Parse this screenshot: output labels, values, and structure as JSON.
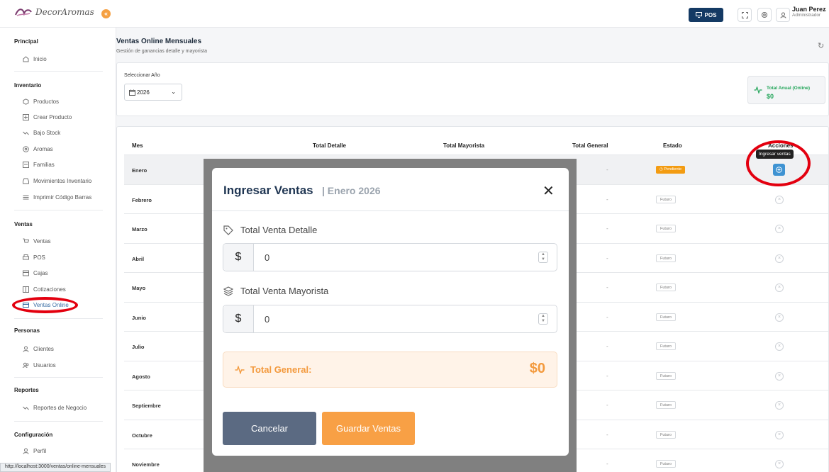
{
  "brand": {
    "name": "DecorAromas"
  },
  "topbar": {
    "pos_label": "POS",
    "user_name": "Juan Perez",
    "user_role": "Administrador"
  },
  "sidebar": {
    "sections": [
      {
        "title": "Principal",
        "items": [
          {
            "label": "Inicio",
            "icon": "home-icon"
          }
        ]
      },
      {
        "title": "Inventario",
        "items": [
          {
            "label": "Productos",
            "icon": "box-icon"
          },
          {
            "label": "Crear Producto",
            "icon": "plus-square-icon"
          },
          {
            "label": "Bajo Stock",
            "icon": "trending-down-icon"
          },
          {
            "label": "Aromas",
            "icon": "flower-icon"
          },
          {
            "label": "Familias",
            "icon": "folder-icon"
          },
          {
            "label": "Movimientos Inventario",
            "icon": "inbox-icon"
          },
          {
            "label": "Imprimir Código Barras",
            "icon": "barcode-icon"
          }
        ]
      },
      {
        "title": "Ventas",
        "items": [
          {
            "label": "Ventas",
            "icon": "cart-icon"
          },
          {
            "label": "POS",
            "icon": "printer-icon"
          },
          {
            "label": "Cajas",
            "icon": "register-icon"
          },
          {
            "label": "Cotizaciones",
            "icon": "columns-icon"
          },
          {
            "label": "Ventas Online",
            "icon": "card-icon"
          }
        ]
      },
      {
        "title": "Personas",
        "items": [
          {
            "label": "Clientes",
            "icon": "user-icon"
          },
          {
            "label": "Usuarios",
            "icon": "users-icon"
          }
        ]
      },
      {
        "title": "Reportes",
        "items": [
          {
            "label": "Reportes de Negocio",
            "icon": "trending-icon"
          }
        ]
      },
      {
        "title": "Configuración",
        "items": [
          {
            "label": "Perfil",
            "icon": "user-icon"
          }
        ]
      }
    ]
  },
  "page": {
    "title": "Ventas Online Mensuales",
    "subtitle": "Gestión de ganancias detalle y mayorista",
    "year_label": "Seleccionar Año",
    "year_value": "2026",
    "total_label": "Total Anual (Online)",
    "total_value": "$0"
  },
  "table": {
    "headers": [
      "Mes",
      "Total Detalle",
      "Total Mayorista",
      "Total General",
      "Estado",
      "Acciones"
    ],
    "rows": [
      {
        "month": "Enero",
        "general": "-",
        "status": "Pendiente"
      },
      {
        "month": "Febrero",
        "general": "-",
        "status": "Futuro"
      },
      {
        "month": "Marzo",
        "general": "-",
        "status": "Futuro"
      },
      {
        "month": "Abril",
        "general": "-",
        "status": "Futuro"
      },
      {
        "month": "Mayo",
        "general": "-",
        "status": "Futuro"
      },
      {
        "month": "Junio",
        "general": "-",
        "status": "Futuro"
      },
      {
        "month": "Julio",
        "general": "-",
        "status": "Futuro"
      },
      {
        "month": "Agosto",
        "general": "-",
        "status": "Futuro"
      },
      {
        "month": "Septiembre",
        "general": "-",
        "status": "Futuro"
      },
      {
        "month": "Octubre",
        "general": "-",
        "status": "Futuro"
      },
      {
        "month": "Noviembre",
        "general": "-",
        "status": "Futuro"
      }
    ],
    "tooltip": "Ingresar ventas"
  },
  "modal": {
    "title": "Ingresar Ventas",
    "subtitle": "| Enero 2026",
    "detalle_label": "Total Venta Detalle",
    "detalle_value": "0",
    "mayorista_label": "Total Venta Mayorista",
    "mayorista_value": "0",
    "currency": "$",
    "total_label": "Total General:",
    "total_value": "$0",
    "cancel_label": "Cancelar",
    "save_label": "Guardar Ventas"
  },
  "status_url": "http://localhost:3000/ventas/online-mensuales",
  "colors": {
    "accent": "#f8a045",
    "navy": "#143a64",
    "success": "#22a559",
    "highlight": "#e3000f"
  }
}
